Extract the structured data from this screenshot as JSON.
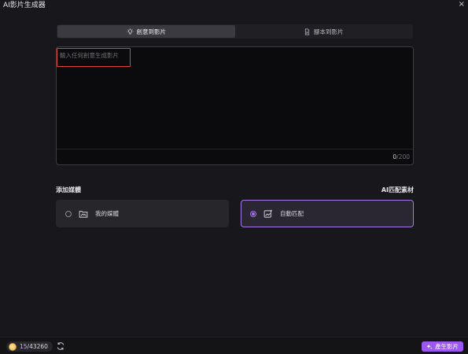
{
  "window": {
    "title": "AI影片生成器",
    "close_symbol": "×"
  },
  "tabs": [
    {
      "label": "創意到影片",
      "icon": "lightbulb-icon",
      "active": true
    },
    {
      "label": "腳本到影片",
      "icon": "document-icon",
      "active": false
    }
  ],
  "prompt": {
    "placeholder": "輸入任何創意生成影片",
    "value": "",
    "char_count": "0",
    "char_limit": "/200"
  },
  "media": {
    "add_label": "添加媒體",
    "match_label": "AI匹配素材",
    "options": [
      {
        "label": "我的媒體",
        "icon": "folder-media-icon",
        "selected": false
      },
      {
        "label": "自動匹配",
        "icon": "image-sparkle-icon",
        "selected": true
      }
    ]
  },
  "footer": {
    "credits_used": "15",
    "credits_total": "/43260",
    "generate_label": "產生影片"
  },
  "colors": {
    "accent": "#9a58f0",
    "highlight": "#e0443a",
    "background": "#18181c"
  }
}
